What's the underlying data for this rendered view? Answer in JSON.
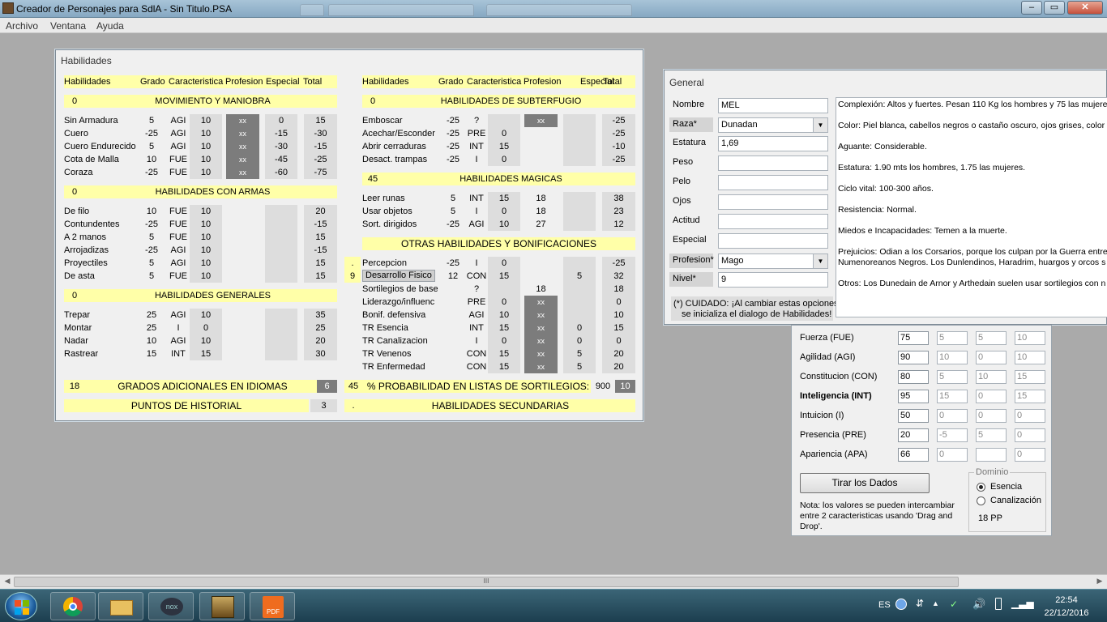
{
  "app": {
    "title": "Creador de Personajes para SdlA - Sin Titulo.PSA",
    "menu": [
      "Archivo",
      "Ventana",
      "Ayuda"
    ],
    "window_controls": {
      "minimize": "–",
      "restore": "▭",
      "close": "✕"
    }
  },
  "habilidades_panel": {
    "title": "Habilidades",
    "headers_left": [
      "Habilidades",
      "Grado",
      "Caracteristica",
      "Profesion",
      "Especial",
      "Total"
    ],
    "headers_right": [
      "Habilidades",
      "Grado",
      "Caracteristica",
      "Profesion",
      "Especial",
      "Total"
    ],
    "movimiento": {
      "count": "0",
      "title": "MOVIMIENTO Y MANIOBRA",
      "rows": [
        [
          "Sin Armadura",
          "5",
          "AGI",
          "10",
          "xx",
          "0",
          "15"
        ],
        [
          "Cuero",
          "-25",
          "AGI",
          "10",
          "xx",
          "-15",
          "-30"
        ],
        [
          "Cuero Endurecido",
          "5",
          "AGI",
          "10",
          "xx",
          "-30",
          "-15"
        ],
        [
          "Cota de Malla",
          "10",
          "FUE",
          "10",
          "xx",
          "-45",
          "-25"
        ],
        [
          "Coraza",
          "-25",
          "FUE",
          "10",
          "xx",
          "-60",
          "-75"
        ]
      ]
    },
    "armas": {
      "count": "0",
      "title": "HABILIDADES CON ARMAS",
      "rows": [
        [
          "De filo",
          "10",
          "FUE",
          "10",
          "",
          "",
          "20"
        ],
        [
          "Contundentes",
          "-25",
          "FUE",
          "10",
          "",
          "",
          "-15"
        ],
        [
          "A 2 manos",
          "5",
          "FUE",
          "10",
          "",
          "",
          "15"
        ],
        [
          "Arrojadizas",
          "-25",
          "AGI",
          "10",
          "",
          "",
          "-15"
        ],
        [
          "Proyectiles",
          "5",
          "AGI",
          "10",
          "",
          "",
          "15"
        ],
        [
          "De asta",
          "5",
          "FUE",
          "10",
          "",
          "",
          "15"
        ]
      ]
    },
    "generales": {
      "count": "0",
      "title": "HABILIDADES GENERALES",
      "rows": [
        [
          "Trepar",
          "25",
          "AGI",
          "10",
          "",
          "",
          "35"
        ],
        [
          "Montar",
          "25",
          "I",
          "0",
          "",
          "",
          "25"
        ],
        [
          "Nadar",
          "10",
          "AGI",
          "10",
          "",
          "",
          "20"
        ],
        [
          "Rastrear",
          "15",
          "INT",
          "15",
          "",
          "",
          "30"
        ]
      ]
    },
    "subterfugio": {
      "count": "0",
      "title": "HABILIDADES DE SUBTERFUGIO",
      "rows": [
        [
          "Emboscar",
          "-25",
          "?",
          "",
          "xx",
          "",
          "-25"
        ],
        [
          "Acechar/Esconder",
          "-25",
          "PRE",
          "0",
          "",
          "",
          "-25"
        ],
        [
          "Abrir cerraduras",
          "-25",
          "INT",
          "15",
          "",
          "",
          "-10"
        ],
        [
          "Desact. trampas",
          "-25",
          "I",
          "0",
          "",
          "",
          "-25"
        ]
      ]
    },
    "magicas": {
      "count": "45",
      "title": "HABILIDADES MAGICAS",
      "rows": [
        [
          "Leer runas",
          "5",
          "INT",
          "15",
          "18",
          "",
          "38"
        ],
        [
          "Usar objetos",
          "5",
          "I",
          "0",
          "18",
          "",
          "23"
        ],
        [
          "Sort. dirigidos",
          "-25",
          "AGI",
          "10",
          "27",
          "",
          "12"
        ]
      ]
    },
    "otras": {
      "title": "OTRAS HABILIDADES Y BONIFICACIONES",
      "side_dot": ".",
      "side_num": "9",
      "rows": [
        [
          "Percepcion",
          "-25",
          "I",
          "0",
          "",
          "",
          "-25"
        ],
        [
          "Desarrollo Fisico",
          "12",
          "CON",
          "15",
          "",
          "5",
          "32"
        ],
        [
          "Sortilegios de base",
          "",
          "?",
          "",
          "18",
          "",
          "18"
        ],
        [
          "Liderazgo/influenc",
          "",
          "PRE",
          "0",
          "xx",
          "",
          "0"
        ],
        [
          "Bonif. defensiva",
          "",
          "AGI",
          "10",
          "xx",
          "",
          "10"
        ],
        [
          "TR Esencia",
          "",
          "INT",
          "15",
          "xx",
          "0",
          "15"
        ],
        [
          "TR Canalizacion",
          "",
          "I",
          "0",
          "xx",
          "0",
          "0"
        ],
        [
          "TR Venenos",
          "",
          "CON",
          "15",
          "xx",
          "5",
          "20"
        ],
        [
          "TR Enfermedad",
          "",
          "CON",
          "15",
          "xx",
          "5",
          "20"
        ]
      ]
    },
    "idiomas": {
      "count": "18",
      "title": "GRADOS ADICIONALES EN IDIOMAS",
      "value": "6"
    },
    "historial": {
      "title": "PUNTOS DE HISTORIAL",
      "value": "3"
    },
    "sortilegios": {
      "count": "45",
      "title": "% PROBABILIDAD EN LISTAS DE SORTILEGIOS:",
      "value1": "900",
      "value2": "10"
    },
    "secundarias": {
      "dot": ".",
      "title": "HABILIDADES SECUNDARIAS"
    }
  },
  "general_panel": {
    "title": "General",
    "fields": {
      "nombre": {
        "label": "Nombre",
        "value": "MEL"
      },
      "raza": {
        "label": "Raza*",
        "value": "Dunadan"
      },
      "estatura": {
        "label": "Estatura",
        "value": "1,69"
      },
      "peso": {
        "label": "Peso",
        "value": ""
      },
      "pelo": {
        "label": "Pelo",
        "value": ""
      },
      "ojos": {
        "label": "Ojos",
        "value": ""
      },
      "actitud": {
        "label": "Actitud",
        "value": ""
      },
      "especial": {
        "label": "Especial",
        "value": ""
      },
      "profesion": {
        "label": "Profesion*",
        "value": "Mago"
      },
      "nivel": {
        "label": "Nivel*",
        "value": "9"
      }
    },
    "warning_line1": "(*) CUIDADO: ¡Al cambiar estas opciones",
    "warning_line2": "se inicializa el dialogo de Habilidades!",
    "description": [
      "Complexión: Altos y fuertes. Pesan 110 Kg los hombres y 75 las mujeres",
      "Color: Piel blanca, cabellos negros o castaño oscuro, ojos grises, color",
      "Aguante: Considerable.",
      "Estatura: 1.90 mts los hombres, 1.75 las mujeres.",
      "Ciclo vital: 100-300 años.",
      "Resistencia: Normal.",
      "Miedos e Incapacidades: Temen a la muerte.",
      "Prejuicios: Odian a los Corsarios, porque los culpan por la Guerra entre",
      "Numenoreanos Negros. Los Dunlendinos, Haradrim, huargos y orcos s",
      "Otros: Los Dunedain de Arnor y Arthedain suelen usar sortilegios con n"
    ]
  },
  "stats_panel": {
    "rows": [
      {
        "label": "Fuerza (FUE)",
        "v": [
          "75",
          "5",
          "5",
          "10"
        ],
        "bold": false
      },
      {
        "label": "Agilidad (AGI)",
        "v": [
          "90",
          "10",
          "0",
          "10"
        ],
        "bold": false
      },
      {
        "label": "Constitucion (CON)",
        "v": [
          "80",
          "5",
          "10",
          "15"
        ],
        "bold": false
      },
      {
        "label": "Inteligencia (INT)",
        "v": [
          "95",
          "15",
          "0",
          "15"
        ],
        "bold": true
      },
      {
        "label": "Intuicion (I)",
        "v": [
          "50",
          "0",
          "0",
          "0"
        ],
        "bold": false
      },
      {
        "label": "Presencia (PRE)",
        "v": [
          "20",
          "-5",
          "5",
          "0"
        ],
        "bold": false
      },
      {
        "label": "Apariencia (APA)",
        "v": [
          "66",
          "0",
          "",
          "0"
        ],
        "bold": false
      }
    ],
    "roll_button": "Tirar los Dados",
    "note_line1": "Nota: los valores se pueden intercambiar",
    "note_line2": "entre 2 caracteristicas usando 'Drag and",
    "note_line3": "Drop'.",
    "dominio": {
      "title": "Dominio",
      "opt1": "Esencia",
      "opt2": "Canalización",
      "pp": "18 PP",
      "selected": "Esencia"
    }
  },
  "scrollbar": {
    "left": "◀",
    "right": "▶",
    "grip": "III"
  },
  "taskbar": {
    "language": "ES",
    "time": "22:54",
    "date": "22/12/2016",
    "apps": [
      "chrome-icon",
      "file-explorer-icon",
      "nox-icon",
      "game-icon",
      "pdf-icon"
    ],
    "nox_label": "nox",
    "pdf_label": "PDF"
  },
  "colors": {
    "section_yellow": "#ffffa8",
    "cell_gray": "#dddddd",
    "xx_gray": "#7c7c7c",
    "desktop": "#aaaaaa"
  }
}
